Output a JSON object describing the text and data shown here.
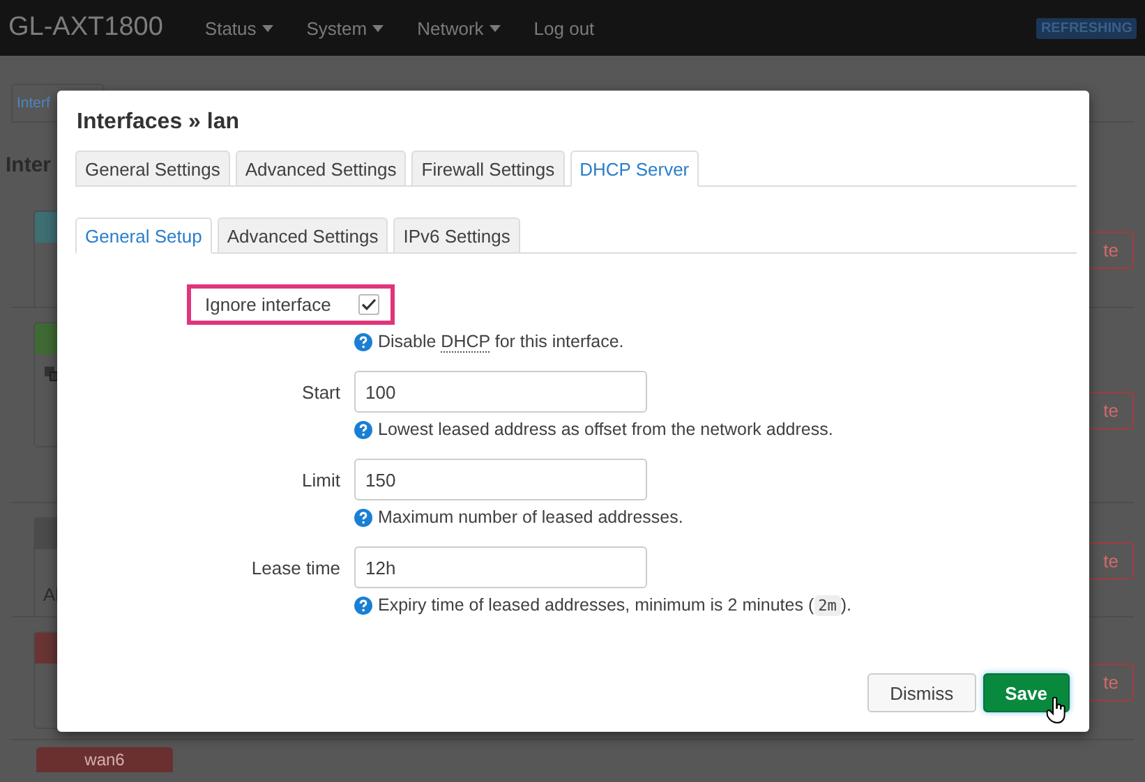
{
  "header": {
    "brand": "GL-AXT1800",
    "menu": [
      {
        "label": "Status",
        "dropdown": true
      },
      {
        "label": "System",
        "dropdown": true
      },
      {
        "label": "Network",
        "dropdown": true
      },
      {
        "label": "Log out",
        "dropdown": false
      }
    ],
    "badge": "REFRESHING"
  },
  "background": {
    "tab": "Interf",
    "heading": "Inter",
    "rows": [
      {
        "color": "#3d6f73",
        "note": "",
        "icon": false,
        "button": "te"
      },
      {
        "color": "#3f6a34",
        "note": "",
        "icon": true,
        "button": "te"
      },
      {
        "color": "#4b4b4b",
        "note": "Al",
        "icon": false,
        "button": "te"
      },
      {
        "color": "#6a3434",
        "note": "",
        "icon": false,
        "button": "te"
      }
    ],
    "last_badge": "wan6"
  },
  "dialog": {
    "title": "Interfaces » lan",
    "tabs": [
      {
        "label": "General Settings",
        "selected": false
      },
      {
        "label": "Advanced Settings",
        "selected": false
      },
      {
        "label": "Firewall Settings",
        "selected": false
      },
      {
        "label": "DHCP Server",
        "selected": true
      }
    ],
    "subtabs": [
      {
        "label": "General Setup",
        "selected": true
      },
      {
        "label": "Advanced Settings",
        "selected": false
      },
      {
        "label": "IPv6 Settings",
        "selected": false
      }
    ],
    "fields": [
      {
        "kind": "checkbox",
        "label": "Ignore interface",
        "checked": true,
        "highlighted": true,
        "help": [
          {
            "kind": "text",
            "text": "Disable "
          },
          {
            "kind": "abbr",
            "text": "DHCP"
          },
          {
            "kind": "text",
            "text": " for this interface."
          }
        ]
      },
      {
        "kind": "text",
        "label": "Start",
        "value": "100",
        "help": [
          {
            "kind": "text",
            "text": "Lowest leased address as offset from the network address."
          }
        ]
      },
      {
        "kind": "text",
        "label": "Limit",
        "value": "150",
        "help": [
          {
            "kind": "text",
            "text": "Maximum number of leased addresses."
          }
        ]
      },
      {
        "kind": "text",
        "label": "Lease time",
        "value": "12h",
        "help": [
          {
            "kind": "text",
            "text": "Expiry time of leased addresses, minimum is 2 minutes ("
          },
          {
            "kind": "code",
            "text": "2m"
          },
          {
            "kind": "text",
            "text": ")."
          }
        ]
      }
    ],
    "buttons": [
      {
        "label": "Dismiss",
        "kind": "secondary"
      },
      {
        "label": "Save",
        "kind": "primary"
      }
    ]
  }
}
